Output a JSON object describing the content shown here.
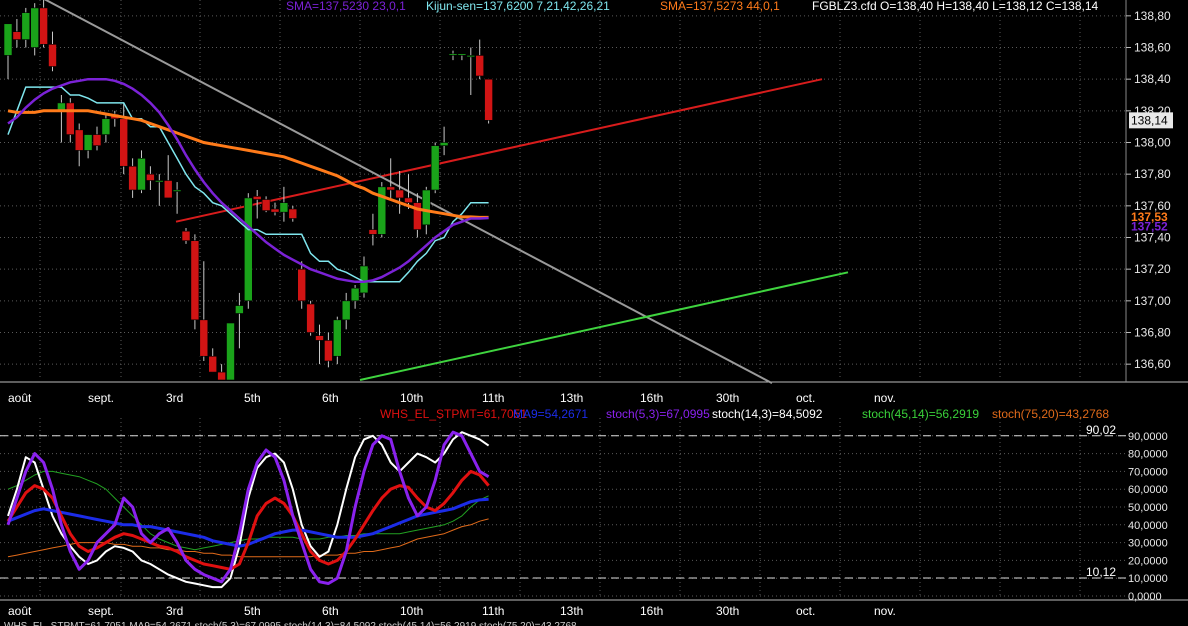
{
  "header": {
    "sma1": "SMA=137,5230  23,0,1",
    "kijun": "Kijun-sen=137,6200  7,21,42,26,21",
    "sma2": "SMA=137,5273  44,0,1",
    "quote": "FGBLZ3.cfd O=138,40 H=138,40 L=138,12 C=138,14"
  },
  "osc_header": {
    "whs": "WHS_EL_STPMT=61,7051",
    "ma": "MA9=54,2671",
    "stoch1": "stoch(5,3)=67,0995",
    "stoch2": "stoch(14,3)=84,5092",
    "stoch3": "stoch(45,14)=56,2919",
    "stoch4": "stoch(75,20)=43,2768"
  },
  "footer": {
    "text": "WHS_EL_STPMT=61,7051  MA9=54,2671  stoch(5,3)=67,0995  stoch(14,3)=84,5092  stoch(45,14)=56,2919  stoch(75,20)=43,2768"
  },
  "colors": {
    "up": "#1aa31a",
    "down": "#d11414",
    "sma1": "#7b22d6",
    "sma2": "#ff7b1a",
    "kijun": "#7fe6ee",
    "trend_red": "#d81c1c",
    "trend_grey": "#9a9a9a",
    "trend_green": "#3fd43f",
    "whs": "#e01010",
    "ma9": "#1c2ce8",
    "stoch5": "#8a22ee",
    "stoch14": "#ffffff",
    "stoch45": "#22a022",
    "stoch75": "#e06a1a"
  },
  "chart_data": [
    {
      "type": "candlestick",
      "title": "FGBLZ3.cfd",
      "ylim": [
        136.5,
        138.9
      ],
      "y_ticks": [
        "138,80",
        "138,60",
        "138,40",
        "138,20",
        "138,00",
        "137,80",
        "137,60",
        "137,40",
        "137,20",
        "137,00",
        "136,80",
        "136,60"
      ],
      "x_tick_labels": [
        "août",
        "sept.",
        "3rd",
        "5th",
        "6th",
        "10th",
        "11th",
        "13th",
        "16th",
        "30th",
        "oct.",
        "nov."
      ],
      "candles": [
        {
          "o": 138.55,
          "h": 138.75,
          "l": 138.4,
          "c": 138.75
        },
        {
          "o": 138.7,
          "h": 138.78,
          "l": 138.6,
          "c": 138.65
        },
        {
          "o": 138.65,
          "h": 138.85,
          "l": 138.6,
          "c": 138.82
        },
        {
          "o": 138.6,
          "h": 138.88,
          "l": 138.55,
          "c": 138.85
        },
        {
          "o": 138.85,
          "h": 138.9,
          "l": 138.6,
          "c": 138.62
        },
        {
          "o": 138.62,
          "h": 138.7,
          "l": 138.45,
          "c": 138.48
        },
        {
          "o": 138.2,
          "h": 138.3,
          "l": 138.0,
          "c": 138.25
        },
        {
          "o": 138.25,
          "h": 138.28,
          "l": 138.0,
          "c": 138.05
        },
        {
          "o": 138.08,
          "h": 138.12,
          "l": 137.85,
          "c": 137.95
        },
        {
          "o": 137.95,
          "h": 138.05,
          "l": 137.9,
          "c": 138.05
        },
        {
          "o": 138.05,
          "h": 138.1,
          "l": 137.95,
          "c": 137.98
        },
        {
          "o": 138.05,
          "h": 138.18,
          "l": 138.0,
          "c": 138.15
        },
        {
          "o": 138.18,
          "h": 138.2,
          "l": 138.1,
          "c": 138.15
        },
        {
          "o": 138.15,
          "h": 138.25,
          "l": 137.8,
          "c": 137.85
        },
        {
          "o": 137.85,
          "h": 137.9,
          "l": 137.65,
          "c": 137.7
        },
        {
          "o": 137.7,
          "h": 137.95,
          "l": 137.68,
          "c": 137.9
        },
        {
          "o": 137.8,
          "h": 137.85,
          "l": 137.7,
          "c": 137.76
        },
        {
          "o": 137.76,
          "h": 137.8,
          "l": 137.6,
          "c": 137.76
        },
        {
          "o": 137.76,
          "h": 137.92,
          "l": 137.65,
          "c": 137.65
        },
        {
          "o": 137.7,
          "h": 137.75,
          "l": 137.55,
          "c": 137.7
        },
        {
          "o": 137.44,
          "h": 137.46,
          "l": 137.36,
          "c": 137.38
        },
        {
          "o": 137.38,
          "h": 137.42,
          "l": 136.82,
          "c": 136.88
        },
        {
          "o": 136.88,
          "h": 137.25,
          "l": 136.62,
          "c": 136.65
        },
        {
          "o": 136.65,
          "h": 136.7,
          "l": 136.55,
          "c": 136.55
        },
        {
          "o": 136.55,
          "h": 136.6,
          "l": 136.5,
          "c": 136.5
        },
        {
          "o": 136.5,
          "h": 136.86,
          "l": 136.5,
          "c": 136.86
        },
        {
          "o": 136.92,
          "h": 137.05,
          "l": 136.7,
          "c": 136.97
        },
        {
          "o": 137.0,
          "h": 137.68,
          "l": 136.95,
          "c": 137.65
        },
        {
          "o": 137.66,
          "h": 137.7,
          "l": 137.52,
          "c": 137.64
        },
        {
          "o": 137.64,
          "h": 137.66,
          "l": 137.56,
          "c": 137.57
        },
        {
          "o": 137.58,
          "h": 137.62,
          "l": 137.54,
          "c": 137.56
        },
        {
          "o": 137.56,
          "h": 137.72,
          "l": 137.5,
          "c": 137.62
        },
        {
          "o": 137.58,
          "h": 137.6,
          "l": 137.5,
          "c": 137.52
        },
        {
          "o": 137.2,
          "h": 137.25,
          "l": 136.95,
          "c": 137.0
        },
        {
          "o": 136.98,
          "h": 137.0,
          "l": 136.78,
          "c": 136.8
        },
        {
          "o": 136.78,
          "h": 136.85,
          "l": 136.6,
          "c": 136.75
        },
        {
          "o": 136.75,
          "h": 136.8,
          "l": 136.58,
          "c": 136.62
        },
        {
          "o": 136.65,
          "h": 136.9,
          "l": 136.6,
          "c": 136.88
        },
        {
          "o": 136.88,
          "h": 137.05,
          "l": 136.82,
          "c": 137.0
        },
        {
          "o": 137.0,
          "h": 137.1,
          "l": 136.95,
          "c": 137.08
        },
        {
          "o": 137.05,
          "h": 137.28,
          "l": 137.02,
          "c": 137.22
        },
        {
          "o": 137.45,
          "h": 137.55,
          "l": 137.35,
          "c": 137.42
        },
        {
          "o": 137.42,
          "h": 137.75,
          "l": 137.4,
          "c": 137.72
        },
        {
          "o": 137.72,
          "h": 137.9,
          "l": 137.65,
          "c": 137.7
        },
        {
          "o": 137.7,
          "h": 137.82,
          "l": 137.55,
          "c": 137.65
        },
        {
          "o": 137.65,
          "h": 137.8,
          "l": 137.58,
          "c": 137.62
        },
        {
          "o": 137.62,
          "h": 137.68,
          "l": 137.4,
          "c": 137.45
        },
        {
          "o": 137.48,
          "h": 137.72,
          "l": 137.42,
          "c": 137.7
        },
        {
          "o": 137.7,
          "h": 138.0,
          "l": 137.68,
          "c": 137.98
        },
        {
          "o": 137.98,
          "h": 138.1,
          "l": 137.92,
          "c": 138.0
        },
        {
          "o": 138.56,
          "h": 138.58,
          "l": 138.52,
          "c": 138.56
        },
        {
          "o": 138.56,
          "h": 138.56,
          "l": 138.52,
          "c": 138.56
        },
        {
          "o": 138.55,
          "h": 138.6,
          "l": 138.3,
          "c": 138.55
        },
        {
          "o": 138.55,
          "h": 138.65,
          "l": 138.4,
          "c": 138.42
        },
        {
          "o": 138.4,
          "h": 138.4,
          "l": 138.12,
          "c": 138.14
        }
      ],
      "sma_23": [
        138.12,
        138.16,
        138.22,
        138.27,
        138.31,
        138.34,
        138.36,
        138.38,
        138.39,
        138.4,
        138.4,
        138.4,
        138.39,
        138.37,
        138.34,
        138.3,
        138.25,
        138.19,
        138.11,
        138.02,
        137.92,
        137.83,
        137.75,
        137.68,
        137.62,
        137.57,
        137.52,
        137.47,
        137.42,
        137.37,
        137.33,
        137.29,
        137.26,
        137.23,
        137.2,
        137.18,
        137.16,
        137.14,
        137.13,
        137.12,
        137.12,
        137.13,
        137.15,
        137.18,
        137.21,
        137.25,
        137.3,
        137.35,
        137.4,
        137.44,
        137.48,
        137.5,
        137.52,
        137.52,
        137.523
      ],
      "sma_44": [
        138.2,
        138.19,
        138.19,
        138.19,
        138.2,
        138.2,
        138.2,
        138.2,
        138.2,
        138.2,
        138.19,
        138.18,
        138.17,
        138.16,
        138.15,
        138.14,
        138.12,
        138.1,
        138.08,
        138.06,
        138.04,
        138.02,
        138.0,
        137.99,
        137.98,
        137.97,
        137.96,
        137.95,
        137.94,
        137.93,
        137.92,
        137.91,
        137.89,
        137.87,
        137.85,
        137.83,
        137.81,
        137.79,
        137.76,
        137.73,
        137.71,
        137.68,
        137.66,
        137.64,
        137.62,
        137.6,
        137.58,
        137.57,
        137.56,
        137.55,
        137.54,
        137.53,
        137.53,
        137.527,
        137.527
      ],
      "kijun_sen": [
        138.05,
        138.2,
        138.35,
        138.35,
        138.35,
        138.35,
        138.35,
        138.3,
        138.3,
        138.28,
        138.25,
        138.25,
        138.25,
        138.25,
        138.15,
        138.15,
        138.1,
        138.1,
        138.0,
        137.9,
        137.8,
        137.72,
        137.68,
        137.62,
        137.6,
        137.55,
        137.5,
        137.45,
        137.45,
        137.42,
        137.42,
        137.42,
        137.42,
        137.42,
        137.3,
        137.25,
        137.25,
        137.2,
        137.18,
        137.15,
        137.12,
        137.12,
        137.12,
        137.12,
        137.12,
        137.18,
        137.25,
        137.3,
        137.38,
        137.4,
        137.5,
        137.55,
        137.62,
        137.62,
        137.62
      ],
      "trendlines": [
        {
          "from": [
            137.5,
            138.48
          ],
          "to": [
            138.4,
            138.62
          ]
        },
        {
          "from": [
            138.92,
            137.3
          ],
          "to": [
            136.48,
            138.82
          ]
        },
        {
          "from": [
            136.5,
            137.3
          ],
          "to": [
            137.18,
            138.92
          ]
        }
      ],
      "last_price_label": "138,14",
      "sma2_label": "137,53",
      "sma1_label": "137,52"
    },
    {
      "type": "line",
      "title": "Oscillators",
      "ylim": [
        0,
        100
      ],
      "y_ticks": [
        "90,0000",
        "80,0000",
        "70,0000",
        "60,0000",
        "50,0000",
        "40,0000",
        "30,0000",
        "20,0000",
        "10,0000",
        "0,0000"
      ],
      "x_tick_labels": [
        "août",
        "sept.",
        "3rd",
        "5th",
        "6th",
        "10th",
        "11th",
        "13th",
        "16th",
        "30th",
        "oct.",
        "nov."
      ],
      "levels": [
        {
          "value": 90.02,
          "label": "90,02"
        },
        {
          "value": 10.12,
          "label": "10,12"
        }
      ],
      "series": [
        {
          "name": "WHS_EL_STPMT",
          "values": [
            42,
            50,
            58,
            62,
            60,
            55,
            45,
            35,
            28,
            25,
            27,
            30,
            33,
            35,
            34,
            32,
            30,
            28,
            27,
            25,
            22,
            20,
            18,
            17,
            16,
            15,
            18,
            30,
            45,
            52,
            55,
            52,
            45,
            35,
            25,
            20,
            18,
            20,
            25,
            32,
            40,
            48,
            55,
            60,
            62,
            61,
            55,
            50,
            48,
            52,
            58,
            65,
            70,
            68,
            62
          ]
        },
        {
          "name": "MA9",
          "values": [
            42,
            44,
            46,
            48,
            49,
            48,
            47,
            46,
            45,
            44,
            43,
            42,
            41,
            40,
            40,
            39,
            39,
            38,
            37,
            36,
            35,
            34,
            33,
            31,
            30,
            29,
            28,
            29,
            31,
            33,
            35,
            36,
            37,
            37,
            36,
            35,
            34,
            33,
            33,
            33,
            34,
            35,
            37,
            39,
            41,
            43,
            45,
            46,
            47,
            48,
            49,
            51,
            53,
            54,
            54.3
          ]
        },
        {
          "name": "stoch(5,3)",
          "values": [
            40,
            55,
            70,
            80,
            75,
            60,
            40,
            25,
            15,
            20,
            30,
            35,
            40,
            55,
            50,
            35,
            30,
            35,
            38,
            30,
            20,
            15,
            12,
            10,
            8,
            15,
            35,
            60,
            75,
            82,
            78,
            65,
            45,
            30,
            15,
            8,
            7,
            10,
            25,
            50,
            70,
            85,
            90,
            88,
            70,
            55,
            45,
            50,
            65,
            85,
            92,
            90,
            80,
            70,
            67
          ]
        },
        {
          "name": "stoch(14,3)",
          "values": [
            45,
            60,
            78,
            75,
            60,
            45,
            35,
            28,
            22,
            18,
            20,
            25,
            28,
            27,
            25,
            20,
            18,
            15,
            12,
            10,
            8,
            7,
            6,
            5,
            5,
            10,
            28,
            55,
            72,
            78,
            80,
            75,
            60,
            40,
            28,
            22,
            25,
            40,
            60,
            78,
            88,
            90,
            85,
            75,
            70,
            75,
            80,
            78,
            75,
            80,
            88,
            92,
            90,
            88,
            84.5
          ]
        },
        {
          "name": "stoch(45,14)",
          "values": [
            60,
            62,
            65,
            68,
            70,
            70,
            69,
            68,
            67,
            65,
            63,
            60,
            55,
            50,
            45,
            40,
            35,
            32,
            30,
            28,
            27,
            26,
            27,
            28,
            29,
            30,
            31,
            32,
            32,
            33,
            33,
            33,
            33,
            32,
            32,
            32,
            33,
            33,
            34,
            34,
            35,
            35,
            35,
            35,
            35,
            36,
            37,
            38,
            39,
            40,
            42,
            45,
            50,
            54,
            56.3
          ]
        },
        {
          "name": "stoch(75,20)",
          "values": [
            22,
            23,
            24,
            25,
            26,
            27,
            28,
            29,
            30,
            30,
            30,
            30,
            29,
            29,
            28,
            28,
            27,
            27,
            26,
            26,
            25,
            25,
            24,
            24,
            23,
            23,
            22,
            22,
            22,
            22,
            22,
            22,
            22,
            22,
            22,
            23,
            23,
            23,
            24,
            24,
            25,
            25,
            26,
            27,
            28,
            30,
            32,
            33,
            34,
            35,
            37,
            39,
            40,
            42,
            43.3
          ]
        }
      ]
    }
  ]
}
